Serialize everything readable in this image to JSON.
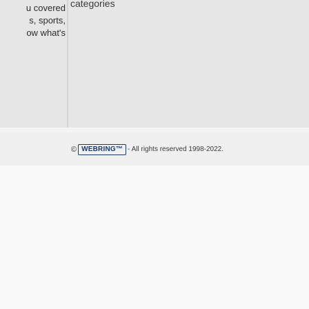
{
  "content": {
    "left_text": "u covered\ns, sports,\now what's",
    "right_text": "categories"
  },
  "footer": {
    "copyright_symbol": "©",
    "brand_name": "WEBRING™",
    "rights_text": "- All rights reserved 1998-2022."
  }
}
